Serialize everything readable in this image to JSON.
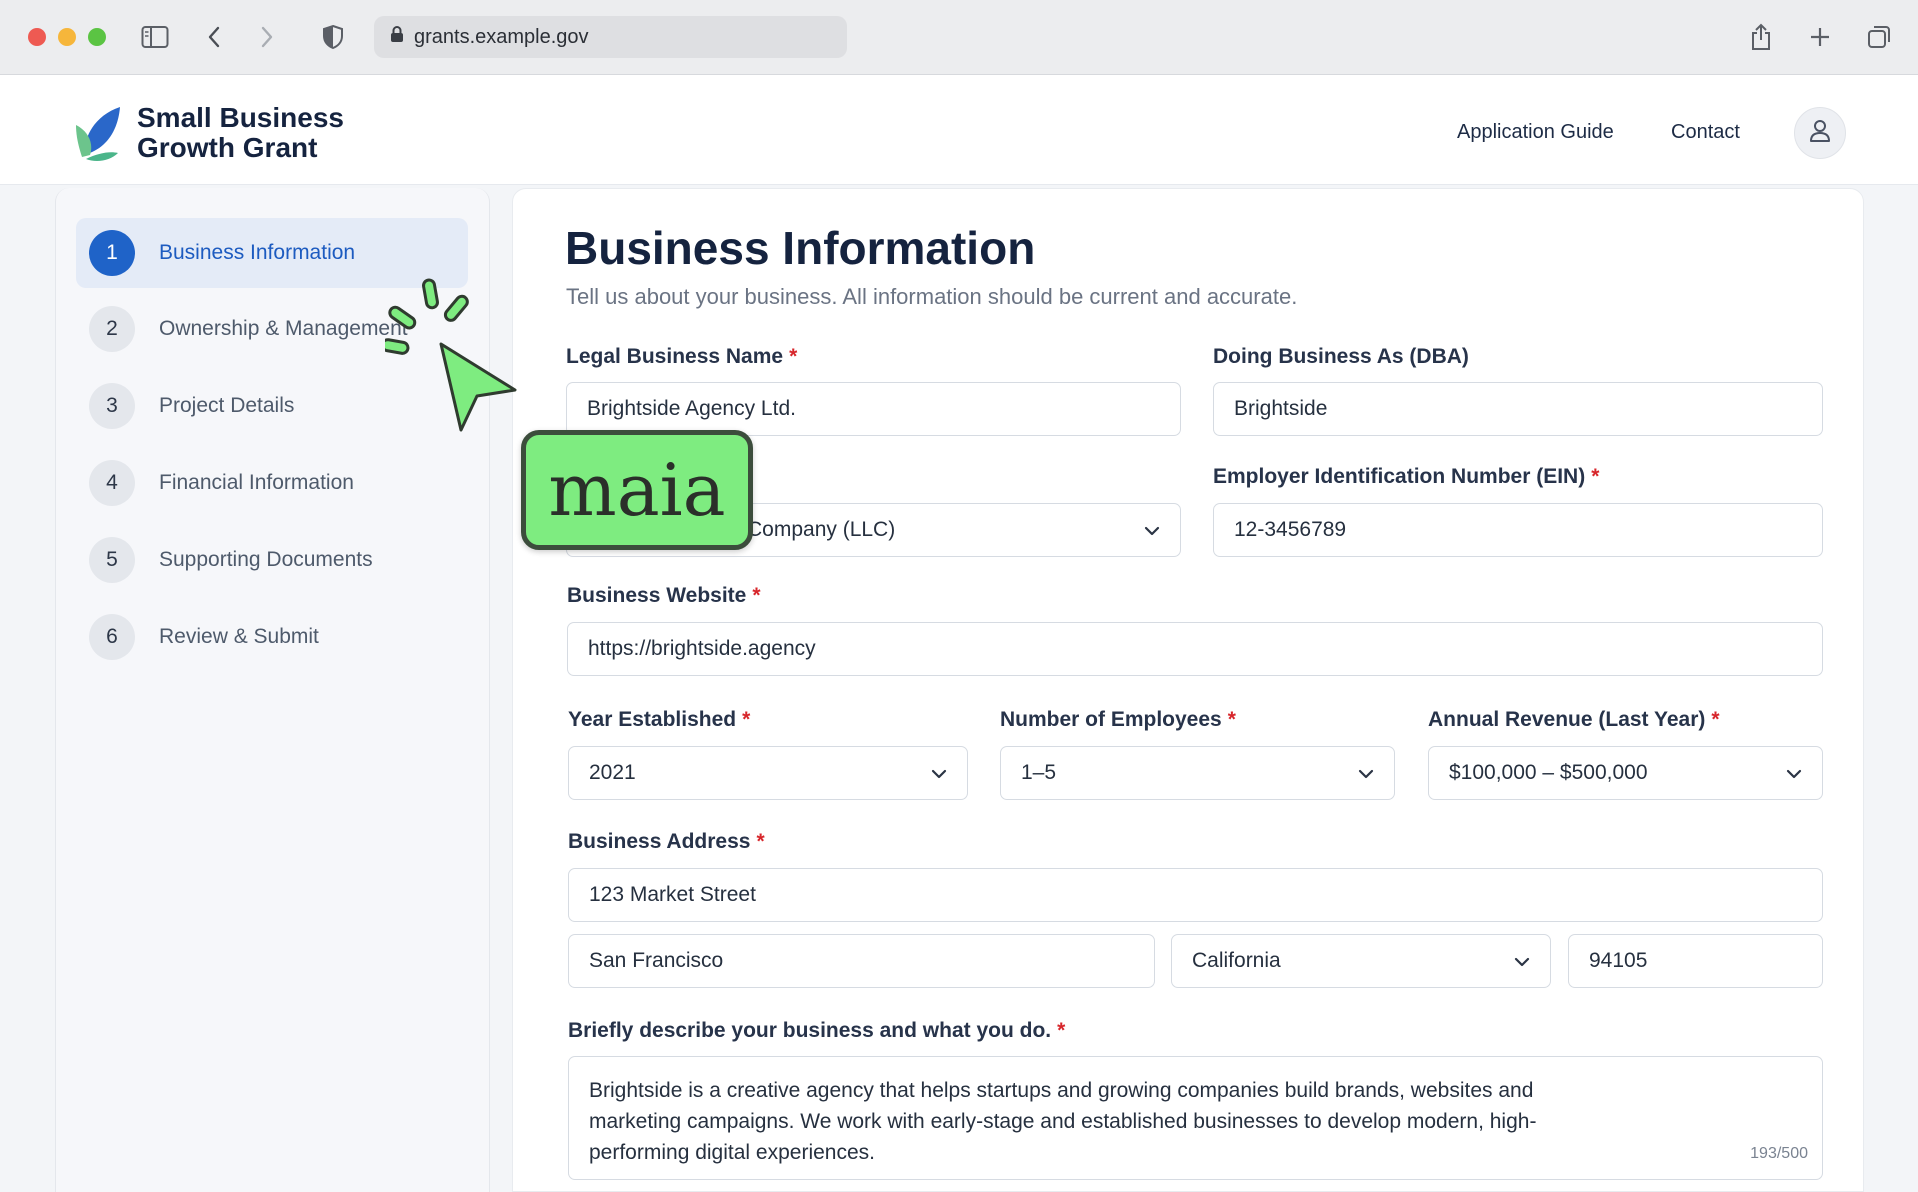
{
  "browser": {
    "url": "grants.example.gov"
  },
  "header": {
    "logo_line1": "Small Business",
    "logo_line2": "Growth Grant",
    "nav": [
      "Application Guide",
      "Contact"
    ]
  },
  "sidebar": {
    "steps": [
      {
        "num": "1",
        "label": "Business Information",
        "active": true
      },
      {
        "num": "2",
        "label": "Ownership & Management",
        "active": false
      },
      {
        "num": "3",
        "label": "Project Details",
        "active": false
      },
      {
        "num": "4",
        "label": "Financial Information",
        "active": false
      },
      {
        "num": "5",
        "label": "Supporting Documents",
        "active": false
      },
      {
        "num": "6",
        "label": "Review & Submit",
        "active": false
      }
    ]
  },
  "form": {
    "title": "Business Information",
    "subtitle": "Tell us about your business. All information should be current and accurate.",
    "legal_name": {
      "label": "Legal Business Name",
      "value": "Brightside Agency Ltd."
    },
    "dba": {
      "label": "Doing Business As (DBA)",
      "value": "Brightside"
    },
    "entity_type": {
      "value": "Company (LLC)"
    },
    "ein": {
      "label": "Employer Identification Number (EIN)",
      "value": "12-3456789"
    },
    "website": {
      "label": "Business Website",
      "value": "https://brightside.agency"
    },
    "year": {
      "label": "Year Established",
      "value": "2021"
    },
    "employees": {
      "label": "Number of Employees",
      "value": "1–5"
    },
    "revenue": {
      "label": "Annual Revenue (Last Year)",
      "value": "$100,000 – $500,000"
    },
    "address": {
      "label": "Business Address",
      "street": "123 Market Street",
      "city": "San Francisco",
      "state": "California",
      "zip": "94105"
    },
    "description": {
      "label": "Briefly describe your business and what you do.",
      "value": "Brightside is a creative agency that helps startups and growing companies build brands, websites and marketing campaigns. We work with early-stage and established businesses to develop modern, high-performing digital experiences.",
      "counter": "193/500"
    },
    "required_mark": "*"
  },
  "overlay": {
    "badge": "maia"
  },
  "colors": {
    "accent": "#1f63c8",
    "required": "#d7262b",
    "badge_bg": "#7eec80"
  }
}
